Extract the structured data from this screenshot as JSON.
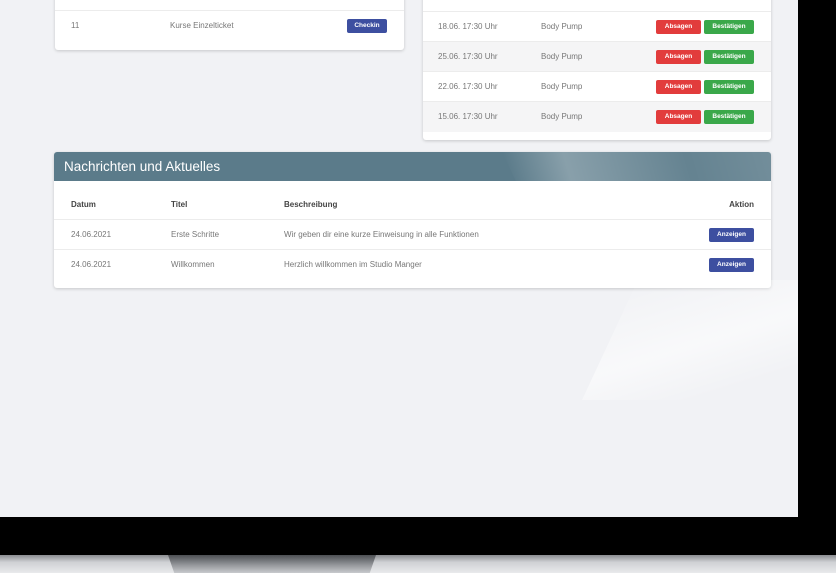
{
  "colors": {
    "checkin": "#3d4fa0",
    "absagen": "#e23c3c",
    "bestaetigen": "#3aa84a",
    "news_header": "#5b7b8a",
    "anzeigen": "#3d4fa0"
  },
  "checkin_card": {
    "rows": [
      {
        "number": "11",
        "product": "Kurse Einzelticket",
        "action": "Checkin"
      }
    ]
  },
  "courses_card": {
    "rows": [
      {
        "datetime": "18.06. 17:30 Uhr",
        "course": "Body Pump",
        "cancel": "Absagen",
        "confirm": "Bestätigen"
      },
      {
        "datetime": "25.06. 17:30 Uhr",
        "course": "Body Pump",
        "cancel": "Absagen",
        "confirm": "Bestätigen"
      },
      {
        "datetime": "22.06. 17:30 Uhr",
        "course": "Body Pump",
        "cancel": "Absagen",
        "confirm": "Bestätigen"
      },
      {
        "datetime": "15.06. 17:30 Uhr",
        "course": "Body Pump",
        "cancel": "Absagen",
        "confirm": "Bestätigen"
      }
    ]
  },
  "news": {
    "title": "Nachrichten und Aktuelles",
    "columns": {
      "date": "Datum",
      "title": "Titel",
      "description": "Beschreibung",
      "action": "Aktion"
    },
    "rows": [
      {
        "date": "24.06.2021",
        "title": "Erste Schritte",
        "description": "Wir geben dir eine kurze Einweisung in alle Funktionen",
        "action": "Anzeigen"
      },
      {
        "date": "24.06.2021",
        "title": "Willkommen",
        "description": "Herzlich willkommen im Studio Manger",
        "action": "Anzeigen"
      }
    ]
  }
}
